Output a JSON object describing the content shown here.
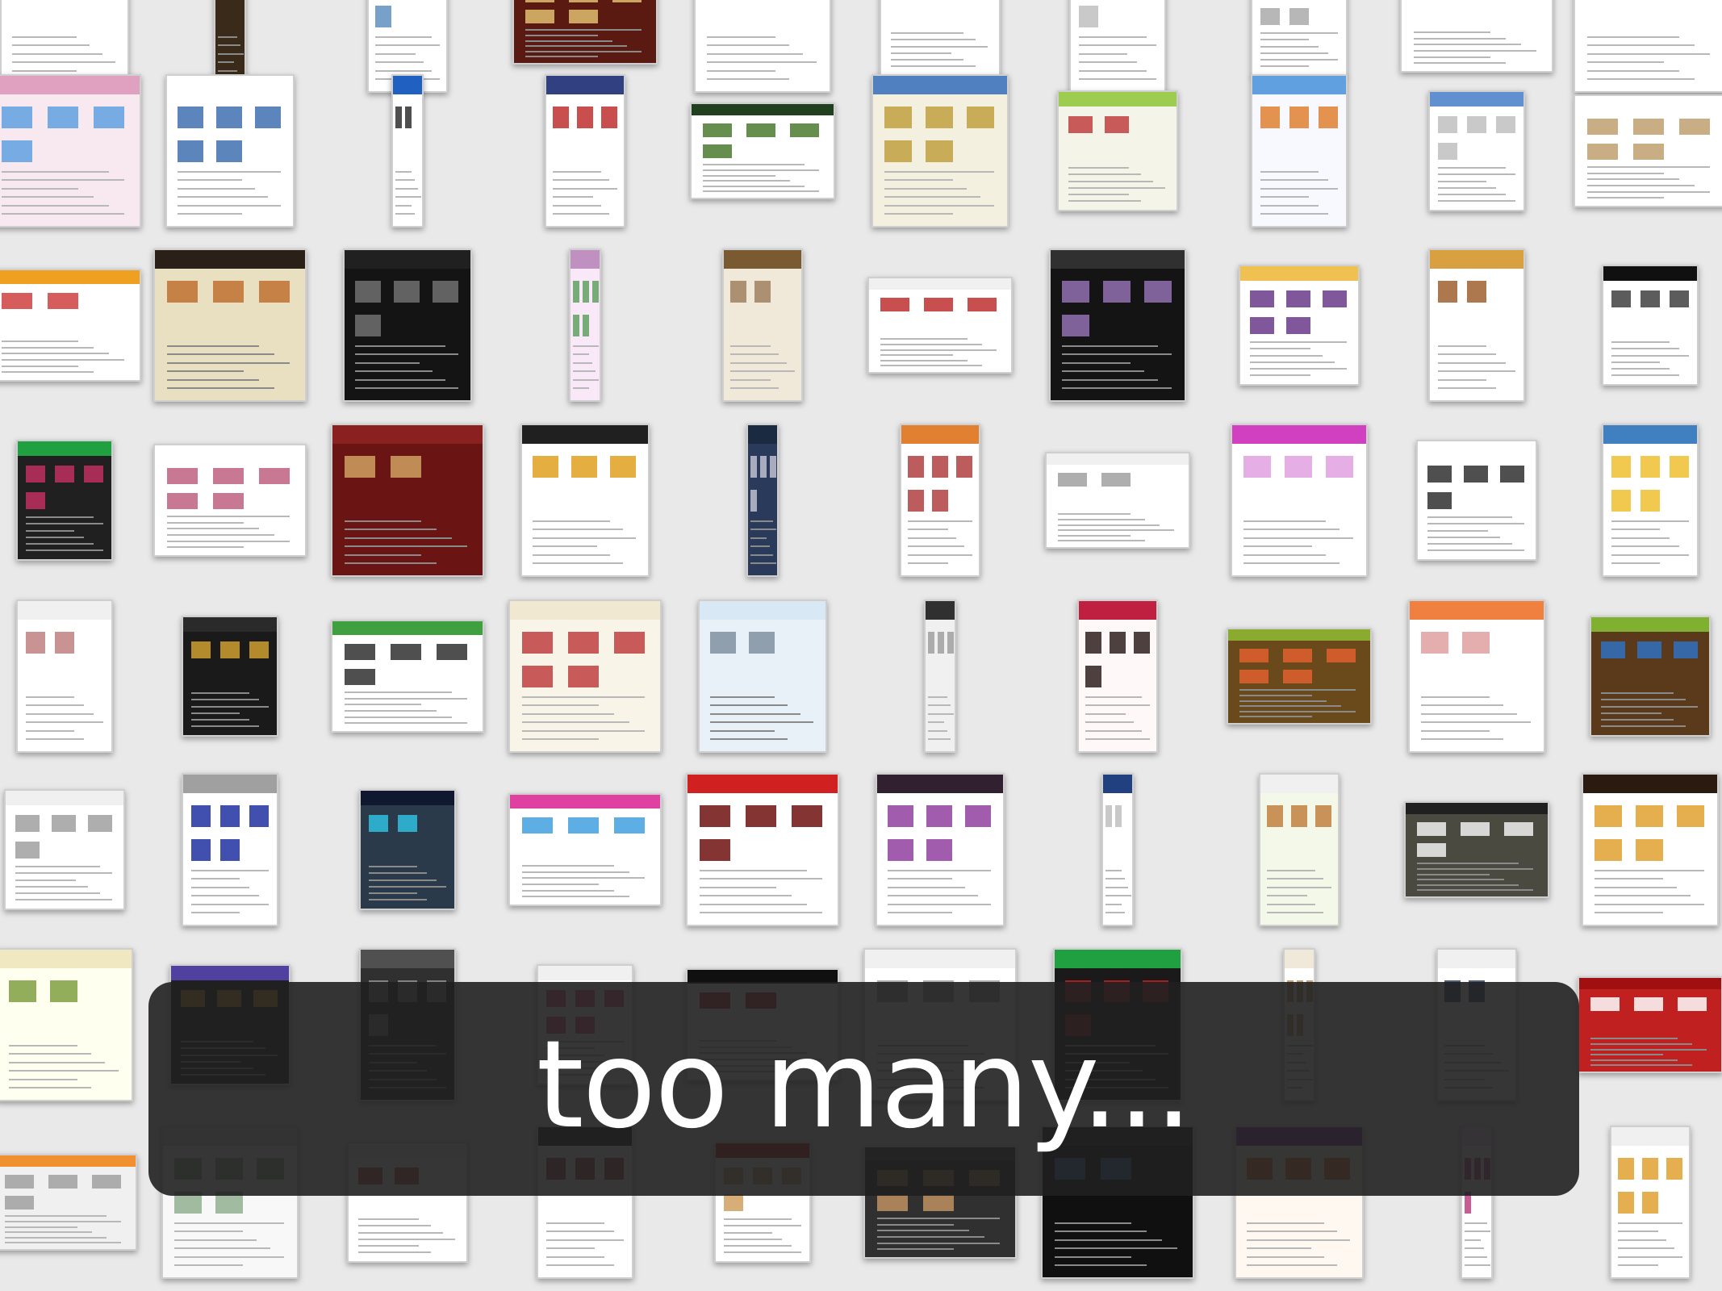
{
  "slide": {
    "caption": "too many...",
    "caption_color": "#ffffff",
    "background_color": "#e9e9e9",
    "bar_color": "#202020"
  },
  "thumbnail_wall": {
    "description_count": 90,
    "palettes": [
      {
        "bg": "#ffffff",
        "hdr": "#dddddd",
        "accent": "#999999"
      },
      {
        "bg": "#3a2a1a",
        "hdr": "#5a3a20",
        "accent": "#d0b070"
      },
      {
        "bg": "#ffffff",
        "hdr": "#e8f0f8",
        "accent": "#6090c0"
      },
      {
        "bg": "#5a1a12",
        "hdr": "#8a2a1a",
        "accent": "#e0c070"
      },
      {
        "bg": "#ffffff",
        "hdr": "#f0f0f0",
        "accent": "#b03030"
      },
      {
        "bg": "#ffffff",
        "hdr": "#202020",
        "accent": "#3060b0"
      },
      {
        "bg": "#ffffff",
        "hdr": "#eeeeee",
        "accent": "#c0c0c0"
      },
      {
        "bg": "#ffffff",
        "hdr": "#e5e5e5",
        "accent": "#aaaaaa"
      },
      {
        "bg": "#ffffff",
        "hdr": "#e040a0",
        "accent": "#c02060"
      },
      {
        "bg": "#ffffff",
        "hdr": "#f5f5f5",
        "accent": "#8090a0"
      },
      {
        "bg": "#f8e8f0",
        "hdr": "#e0a0c0",
        "accent": "#60a0e0"
      },
      {
        "bg": "#ffffff",
        "hdr": "#ffffff",
        "accent": "#4070b0"
      },
      {
        "bg": "#ffffff",
        "hdr": "#2060c0",
        "accent": "#303030"
      },
      {
        "bg": "#ffffff",
        "hdr": "#304080",
        "accent": "#c03030"
      },
      {
        "bg": "#ffffff",
        "hdr": "#204020",
        "accent": "#4a7a30"
      },
      {
        "bg": "#f4f0e0",
        "hdr": "#5080c0",
        "accent": "#c0a040"
      },
      {
        "bg": "#f4f4e8",
        "hdr": "#9ccc50",
        "accent": "#c04040"
      },
      {
        "bg": "#f8f8ff",
        "hdr": "#60a0e0",
        "accent": "#e08030"
      },
      {
        "bg": "#ffffff",
        "hdr": "#6090d0",
        "accent": "#c0c0c0"
      },
      {
        "bg": "#ffffff",
        "hdr": "#ffffff",
        "accent": "#c0a070"
      },
      {
        "bg": "#ffffff",
        "hdr": "#f0a020",
        "accent": "#d04040"
      },
      {
        "bg": "#e8e0c0",
        "hdr": "#2a2018",
        "accent": "#c07030"
      },
      {
        "bg": "#141414",
        "hdr": "#202020",
        "accent": "#707070"
      },
      {
        "bg": "#f8e8f8",
        "hdr": "#c090c0",
        "accent": "#60a060"
      },
      {
        "bg": "#f0e8d8",
        "hdr": "#7a5a30",
        "accent": "#a08060"
      },
      {
        "bg": "#ffffff",
        "hdr": "#f0f0f0",
        "accent": "#c03030"
      },
      {
        "bg": "#141414",
        "hdr": "#303030",
        "accent": "#9070b0"
      },
      {
        "bg": "#ffffff",
        "hdr": "#f0c050",
        "accent": "#6a3a8a"
      },
      {
        "bg": "#ffffff",
        "hdr": "#d8a040",
        "accent": "#a06030"
      },
      {
        "bg": "#ffffff",
        "hdr": "#101010",
        "accent": "#404040"
      },
      {
        "bg": "#202020",
        "hdr": "#20a040",
        "accent": "#c03060"
      },
      {
        "bg": "#ffffff",
        "hdr": "#ffffff",
        "accent": "#c06080"
      },
      {
        "bg": "#6a1414",
        "hdr": "#8a2020",
        "accent": "#d0a060"
      },
      {
        "bg": "#ffffff",
        "hdr": "#202020",
        "accent": "#e0a020"
      },
      {
        "bg": "#2a3a5a",
        "hdr": "#1a2a40",
        "accent": "#c0c0d0"
      },
      {
        "bg": "#ffffff",
        "hdr": "#e08030",
        "accent": "#b04040"
      },
      {
        "bg": "#ffffff",
        "hdr": "#f0f0f0",
        "accent": "#a0a0a0"
      },
      {
        "bg": "#ffffff",
        "hdr": "#d040c0",
        "accent": "#e0a0e0"
      },
      {
        "bg": "#ffffff",
        "hdr": "#ffffff",
        "accent": "#303030"
      },
      {
        "bg": "#ffffff",
        "hdr": "#4080c0",
        "accent": "#f0c030"
      },
      {
        "bg": "#ffffff",
        "hdr": "#f0f0f0",
        "accent": "#c08080"
      },
      {
        "bg": "#1a1a1a",
        "hdr": "#2a2a2a",
        "accent": "#d0a030"
      },
      {
        "bg": "#ffffff",
        "hdr": "#40a040",
        "accent": "#303030"
      },
      {
        "bg": "#f8f4e8",
        "hdr": "#f0e8d0",
        "accent": "#c04040"
      },
      {
        "bg": "#e8f0f8",
        "hdr": "#d8e8f4",
        "accent": "#8090a0"
      },
      {
        "bg": "#f0f0f0",
        "hdr": "#303030",
        "accent": "#a0a0a0"
      },
      {
        "bg": "#fff8f8",
        "hdr": "#c02040",
        "accent": "#302020"
      },
      {
        "bg": "#6a4a1a",
        "hdr": "#8aaa30",
        "accent": "#e06030"
      },
      {
        "bg": "#ffffff",
        "hdr": "#f08040",
        "accent": "#e0a0a0"
      },
      {
        "bg": "#5a3a1a",
        "hdr": "#80b030",
        "accent": "#3070c0"
      },
      {
        "bg": "#ffffff",
        "hdr": "#f0f0f0",
        "accent": "#a0a0a0"
      },
      {
        "bg": "#ffffff",
        "hdr": "#a0a0a0",
        "accent": "#2030a0"
      },
      {
        "bg": "#2a3a4a",
        "hdr": "#101830",
        "accent": "#30c0e0"
      },
      {
        "bg": "#ffffff",
        "hdr": "#e040a0",
        "accent": "#40a0e0"
      },
      {
        "bg": "#ffffff",
        "hdr": "#d02020",
        "accent": "#701010"
      },
      {
        "bg": "#ffffff",
        "hdr": "#302030",
        "accent": "#9040a0"
      },
      {
        "bg": "#ffffff",
        "hdr": "#204080",
        "accent": "#c0c0c0"
      },
      {
        "bg": "#f4f8e8",
        "hdr": "#f0f0f0",
        "accent": "#c08040"
      },
      {
        "bg": "#4a4a40",
        "hdr": "#202020",
        "accent": "#f0f0f0"
      },
      {
        "bg": "#ffffff",
        "hdr": "#2a1a10",
        "accent": "#e0a030"
      },
      {
        "bg": "#fffff0",
        "hdr": "#f0e8c0",
        "accent": "#80a040"
      },
      {
        "bg": "#202020",
        "hdr": "#5040a0",
        "accent": "#f0c020"
      },
      {
        "bg": "#303030",
        "hdr": "#505050",
        "accent": "#909090"
      },
      {
        "bg": "#ffffff",
        "hdr": "#f0f0f0",
        "accent": "#e04080"
      },
      {
        "bg": "#ffffff",
        "hdr": "#101010",
        "accent": "#c02020"
      },
      {
        "bg": "#ffffff",
        "hdr": "#f0f0f0",
        "accent": "#a0a0a0"
      },
      {
        "bg": "#1a1a1a",
        "hdr": "#20a040",
        "accent": "#c02020"
      },
      {
        "bg": "#ffffff",
        "hdr": "#f0e8d8",
        "accent": "#c09060"
      },
      {
        "bg": "#ffffff",
        "hdr": "#f0f0f0",
        "accent": "#304060"
      },
      {
        "bg": "#c02020",
        "hdr": "#a01010",
        "accent": "#ffffff"
      },
      {
        "bg": "#f0f0f0",
        "hdr": "#f09030",
        "accent": "#a0a0a0"
      },
      {
        "bg": "#f8f8f8",
        "hdr": "#e0e0e0",
        "accent": "#90b090"
      },
      {
        "bg": "#ffffff",
        "hdr": "#f0f0f0",
        "accent": "#b04040"
      },
      {
        "bg": "#ffffff",
        "hdr": "#202020",
        "accent": "#a04040"
      },
      {
        "bg": "#ffffff",
        "hdr": "#c02020",
        "accent": "#d0a060"
      },
      {
        "bg": "#303030",
        "hdr": "#404040",
        "accent": "#c09060"
      },
      {
        "bg": "#101010",
        "hdr": "#202020",
        "accent": "#4080c0"
      },
      {
        "bg": "#fff8f0",
        "hdr": "#8040a0",
        "accent": "#e07020"
      },
      {
        "bg": "#ffffff",
        "hdr": "#f0e0f0",
        "accent": "#c04080"
      },
      {
        "bg": "#ffffff",
        "hdr": "#f0f0f0",
        "accent": "#e0a030"
      }
    ]
  }
}
